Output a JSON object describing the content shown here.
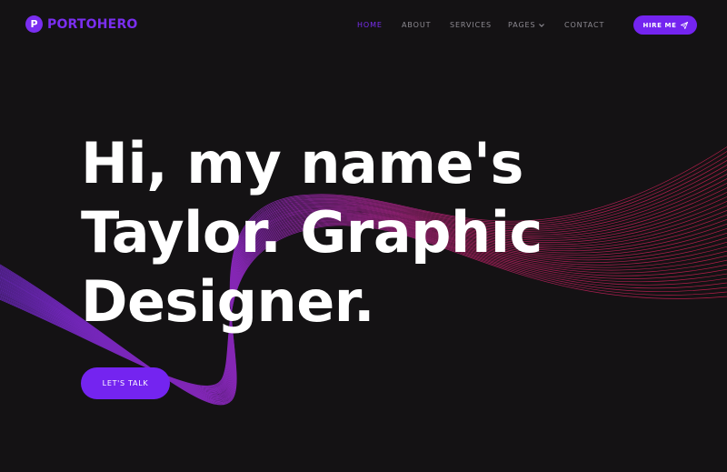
{
  "brand": {
    "logo_letter": "P",
    "name": "PORTOHERO"
  },
  "nav": {
    "items": [
      {
        "label": "HOME",
        "active": true
      },
      {
        "label": "ABOUT",
        "active": false
      },
      {
        "label": "SERVICES",
        "active": false
      },
      {
        "label": "PAGES",
        "active": false,
        "has_dropdown": true
      },
      {
        "label": "CONTACT",
        "active": false
      }
    ],
    "hire_button": {
      "label": "HIRE ME",
      "icon": "paper-plane-icon"
    }
  },
  "hero": {
    "lines": [
      "Hi, my name's",
      "Taylor. Graphic",
      "Designer."
    ],
    "cta_label": "LET'S TALK"
  },
  "colors": {
    "background": "#141214",
    "accent": "#7424f0",
    "nav_text": "#8d8a91",
    "wave_purple": "#7b2be0",
    "wave_red": "#d0204e"
  }
}
